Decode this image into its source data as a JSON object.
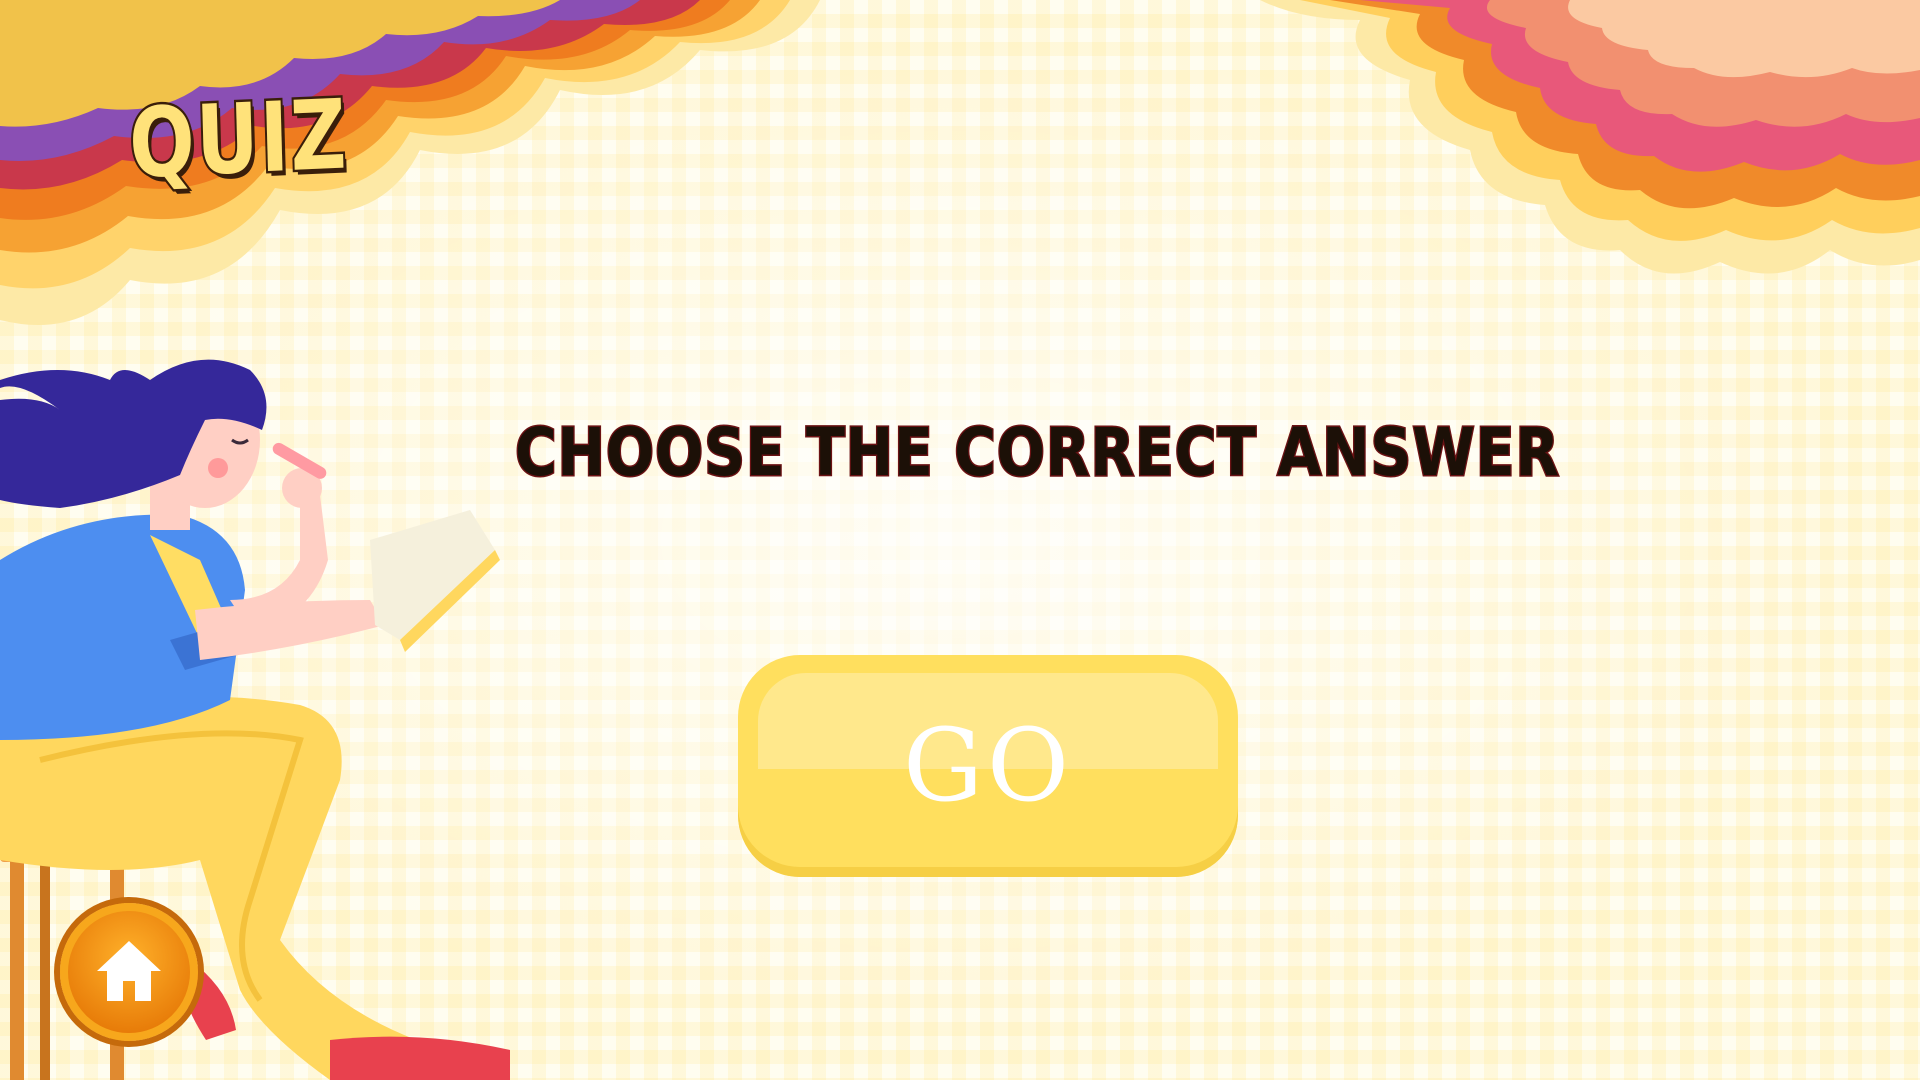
{
  "header": {
    "logo_text": "QUIZ"
  },
  "main": {
    "instruction": "CHOOSE THE CORRECT ANSWER",
    "go_button_label": "GO"
  },
  "nav": {
    "home_icon": "home-icon"
  },
  "colors": {
    "background": "#fffdf0",
    "go_button": "#ffdf5e",
    "home_button": "#f08a10",
    "instruction_text": "#1c1007",
    "logo_fill": "#ffe27a"
  }
}
